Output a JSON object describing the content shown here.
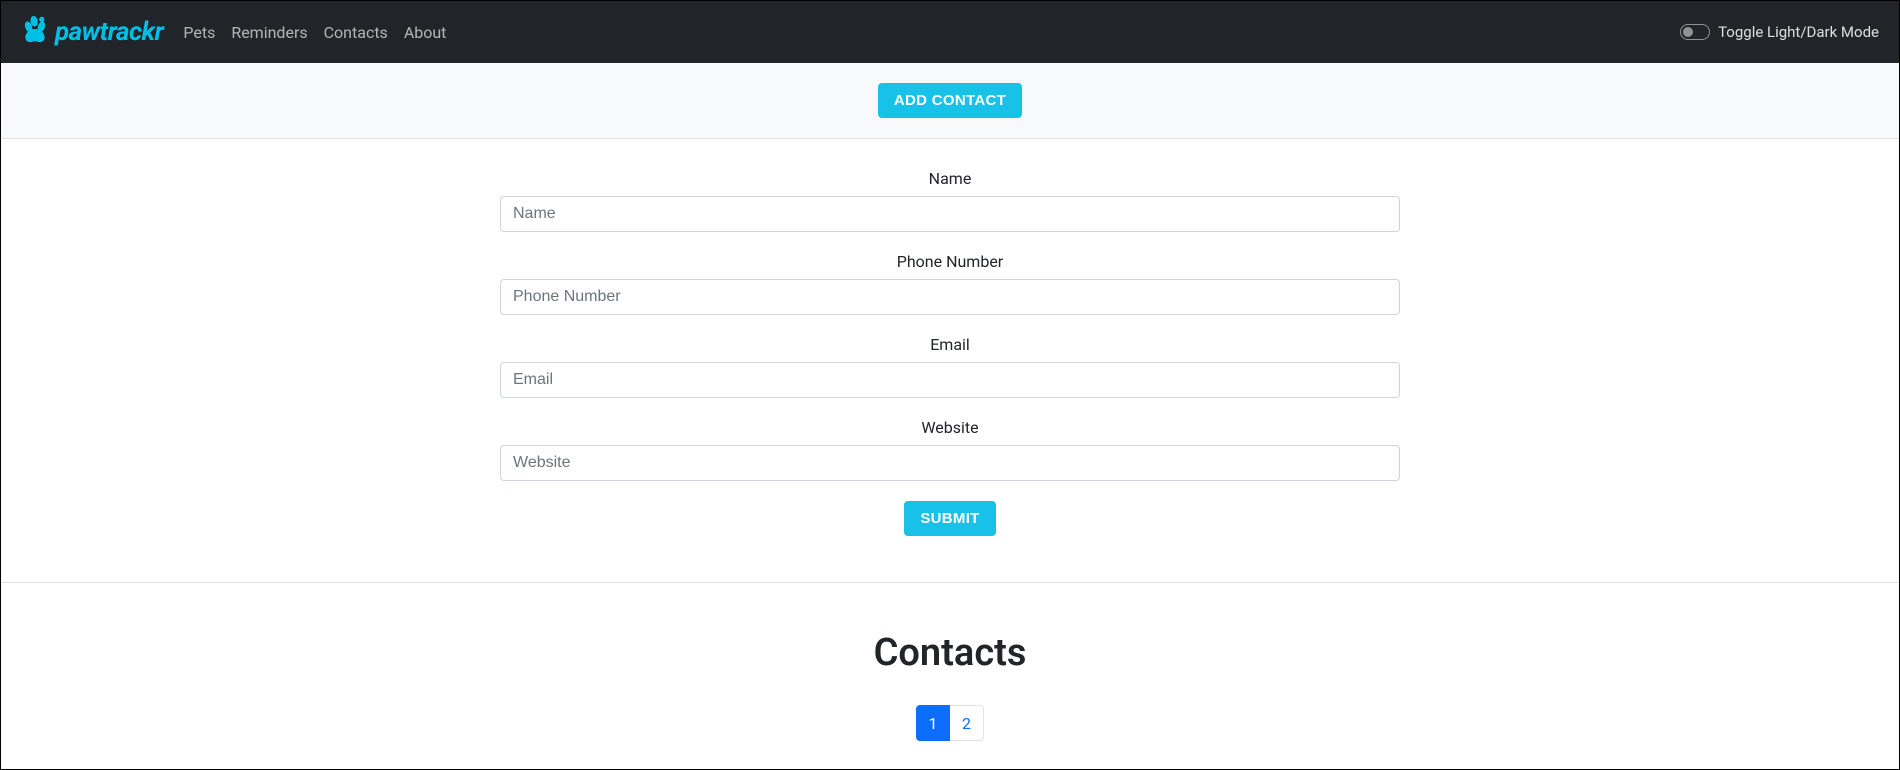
{
  "brand": {
    "name": "pawtrackr"
  },
  "nav": {
    "items": [
      {
        "label": "Pets"
      },
      {
        "label": "Reminders"
      },
      {
        "label": "Contacts"
      },
      {
        "label": "About"
      }
    ],
    "toggle_label": "Toggle Light/Dark Mode"
  },
  "add_bar": {
    "button_label": "ADD CONTACT"
  },
  "form": {
    "fields": [
      {
        "label": "Name",
        "placeholder": "Name"
      },
      {
        "label": "Phone Number",
        "placeholder": "Phone Number"
      },
      {
        "label": "Email",
        "placeholder": "Email"
      },
      {
        "label": "Website",
        "placeholder": "Website"
      }
    ],
    "submit_label": "SUBMIT"
  },
  "contacts": {
    "heading": "Contacts",
    "pagination": {
      "pages": [
        "1",
        "2"
      ],
      "active": "1"
    }
  }
}
